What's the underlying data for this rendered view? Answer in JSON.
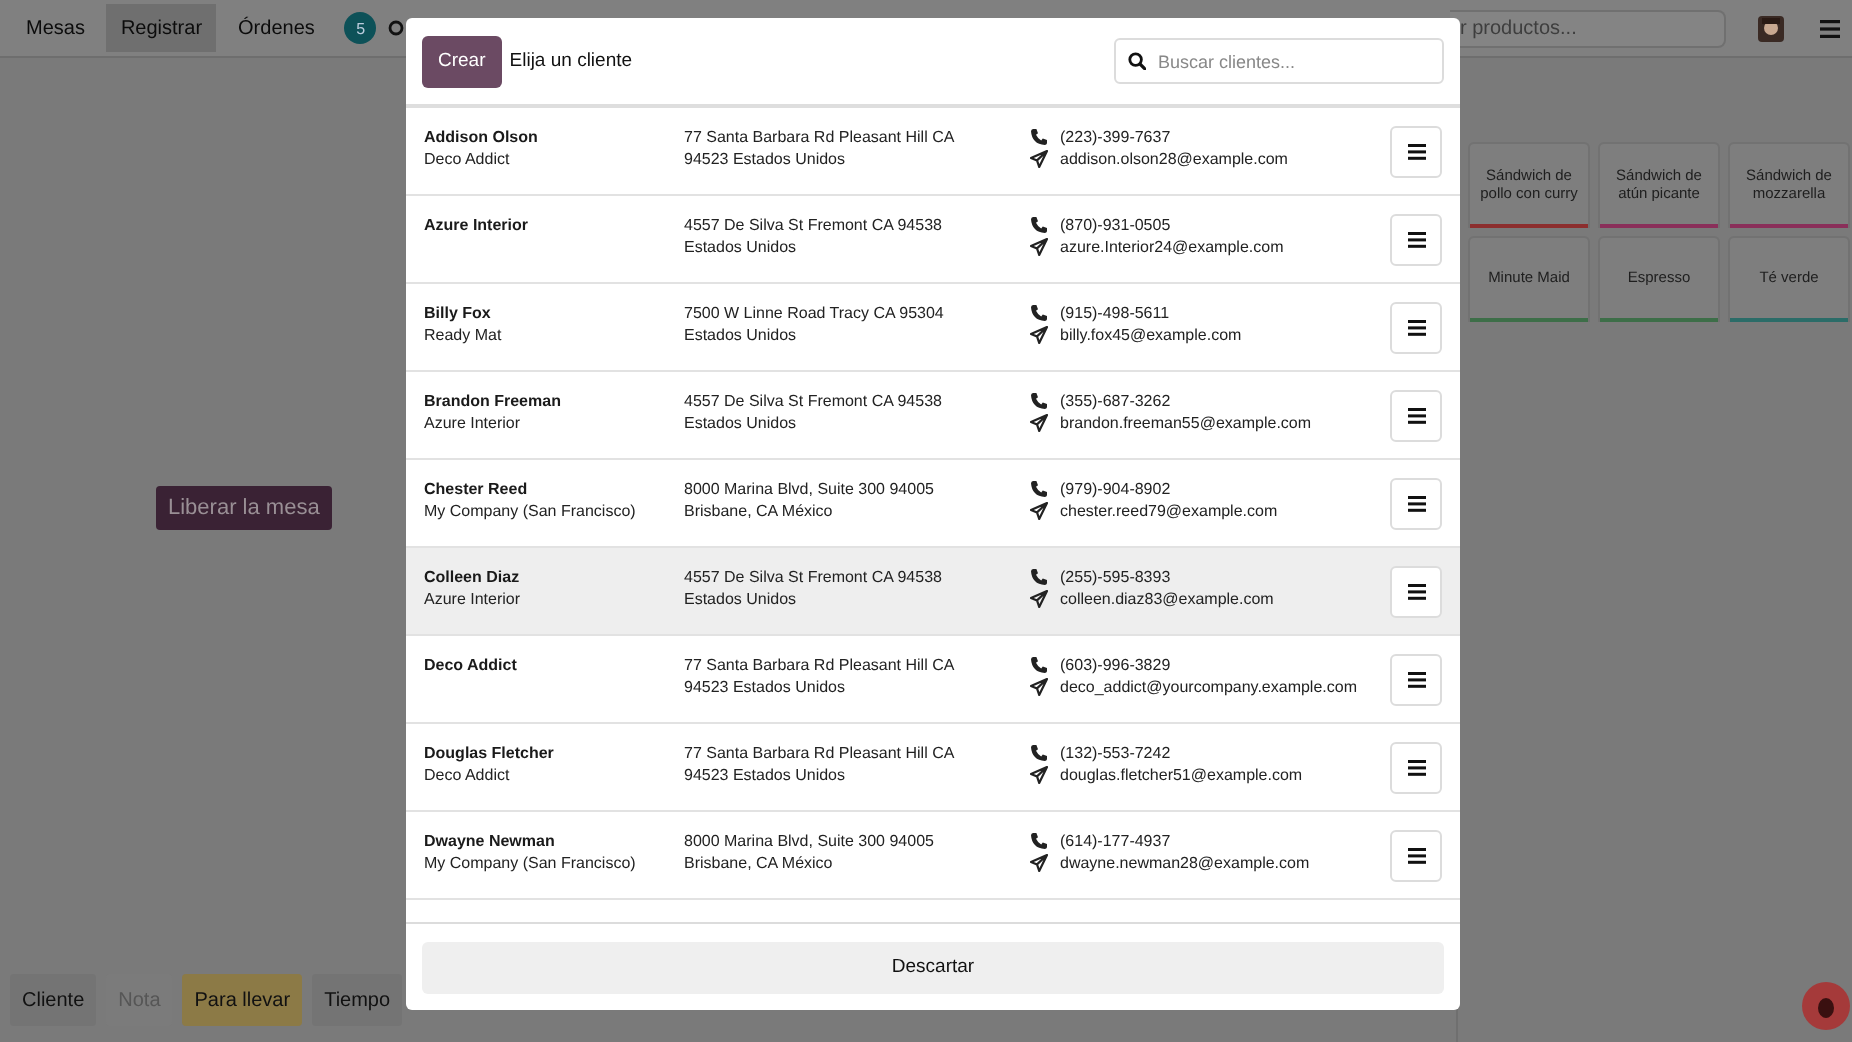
{
  "topbar": {
    "tabs": [
      {
        "label": "Mesas",
        "selected": false
      },
      {
        "label": "Registrar",
        "selected": true
      },
      {
        "label": "Órdenes",
        "selected": false
      }
    ],
    "orders_badge": "5",
    "product_search": {
      "placeholder": "r productos..."
    }
  },
  "order_panel": {
    "release_button": "Liberar la mesa",
    "actions": [
      {
        "label": "Cliente",
        "disabled": false,
        "active": false
      },
      {
        "label": "Nota",
        "disabled": true,
        "active": false
      },
      {
        "label": "Para llevar",
        "disabled": false,
        "active": true
      },
      {
        "label": "Tiempo",
        "disabled": false,
        "active": false
      }
    ]
  },
  "products": [
    {
      "name": "Sándwich de pollo con curry",
      "color": "#8c2e2e"
    },
    {
      "name": "Sándwich de atún picante",
      "color": "#8a2f5a"
    },
    {
      "name": "Sándwich de mozzarella",
      "color": "#8a2f5a"
    },
    {
      "name": "Minute Maid",
      "color": "#3d6e48"
    },
    {
      "name": "Espresso",
      "color": "#3d6e48"
    },
    {
      "name": "Té verde",
      "color": "#2b6c68"
    }
  ],
  "dialog": {
    "create_button": "Crear",
    "title": "Elija un cliente",
    "search": {
      "placeholder": "Buscar clientes..."
    },
    "clients": [
      {
        "name": "Addison Olson",
        "company": "Deco Addict",
        "address": "77 Santa Barbara Rd Pleasant Hill CA 94523 Estados Unidos",
        "phone": "(223)-399-7637",
        "email": "addison.olson28@example.com",
        "highlighted": false
      },
      {
        "name": "Azure Interior",
        "address": "4557 De Silva St Fremont CA 94538 Estados Unidos",
        "phone": "(870)-931-0505",
        "email": "azure.Interior24@example.com",
        "highlighted": false
      },
      {
        "name": "Billy Fox",
        "company": "Ready Mat",
        "address": "7500 W Linne Road Tracy CA 95304 Estados Unidos",
        "phone": "(915)-498-5611",
        "email": "billy.fox45@example.com",
        "highlighted": false
      },
      {
        "name": "Brandon Freeman",
        "company": "Azure Interior",
        "address": "4557 De Silva St Fremont CA 94538 Estados Unidos",
        "phone": "(355)-687-3262",
        "email": "brandon.freeman55@example.com",
        "highlighted": false
      },
      {
        "name": "Chester Reed",
        "company": "My Company (San Francisco)",
        "address": "8000 Marina Blvd, Suite 300 94005 Brisbane, CA México",
        "phone": "(979)-904-8902",
        "email": "chester.reed79@example.com",
        "highlighted": false
      },
      {
        "name": "Colleen Diaz",
        "company": "Azure Interior",
        "address": "4557 De Silva St Fremont CA 94538 Estados Unidos",
        "phone": "(255)-595-8393",
        "email": "colleen.diaz83@example.com",
        "highlighted": true
      },
      {
        "name": "Deco Addict",
        "address": "77 Santa Barbara Rd Pleasant Hill CA 94523 Estados Unidos",
        "phone": "(603)-996-3829",
        "email": "deco_addict@yourcompany.example.com",
        "highlighted": false
      },
      {
        "name": "Douglas Fletcher",
        "company": "Deco Addict",
        "address": "77 Santa Barbara Rd Pleasant Hill CA 94523 Estados Unidos",
        "phone": "(132)-553-7242",
        "email": "douglas.fletcher51@example.com",
        "highlighted": false
      },
      {
        "name": "Dwayne Newman",
        "company": "My Company (San Francisco)",
        "address": "8000 Marina Blvd, Suite 300 94005 Brisbane, CA México",
        "phone": "(614)-177-4937",
        "email": "dwayne.newman28@example.com",
        "highlighted": false
      }
    ],
    "discard_button": "Descartar"
  }
}
